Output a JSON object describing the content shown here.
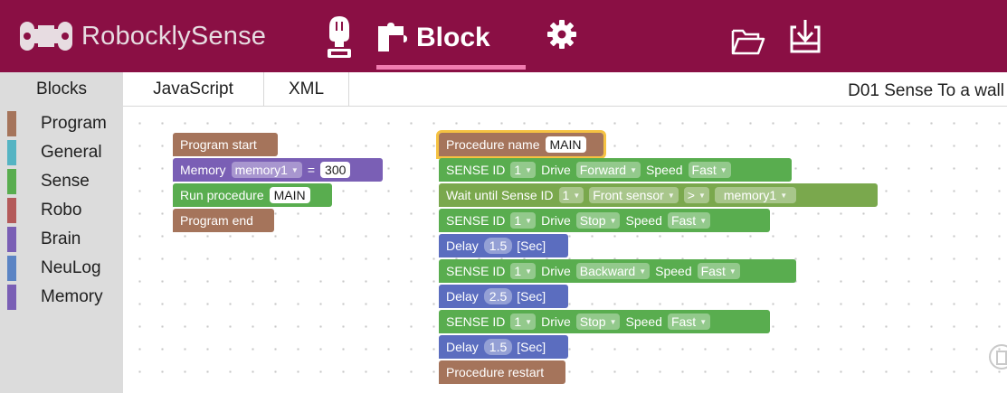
{
  "header": {
    "app_name": "RobocklySense",
    "active_tab_label": "Block",
    "icons": [
      "logo-icon",
      "robot-icon",
      "puzzle-icon",
      "gear-icon",
      "folder-icon",
      "download-icon"
    ],
    "brand_color": "#8a0f44",
    "active_underline_color": "#f07cb0"
  },
  "tabs": {
    "blocks": "Blocks",
    "javascript": "JavaScript",
    "xml": "XML"
  },
  "project_title": "D01 Sense To a wall",
  "toolbox": {
    "categories": [
      {
        "label": "Program",
        "color": "#a5745b"
      },
      {
        "label": "General",
        "color": "#55b4c3"
      },
      {
        "label": "Sense",
        "color": "#59ad4f"
      },
      {
        "label": "Robo",
        "color": "#b45a5a"
      },
      {
        "label": "Brain",
        "color": "#7a5fb5"
      },
      {
        "label": "NeuLog",
        "color": "#5b84c4"
      },
      {
        "label": "Memory",
        "color": "#7a5fb5"
      }
    ]
  },
  "program": {
    "start": "Program start",
    "memory_label": "Memory",
    "memory_var": "memory1",
    "equals": "=",
    "memory_value": "300",
    "run_label": "Run procedure",
    "run_name": "MAIN",
    "end": "Program end"
  },
  "procedure": {
    "name_label": "Procedure name",
    "name_value": "MAIN",
    "sense_label": "SENSE ID",
    "drive_label": "Drive",
    "speed_label": "Speed",
    "wait_label": "Wait until Sense ID",
    "delay_label": "Delay",
    "sec_label": "[Sec]",
    "restart": "Procedure restart",
    "s1": {
      "id": "1",
      "drive": "Forward",
      "speed": "Fast"
    },
    "wait": {
      "id": "1",
      "sensor": "Front sensor",
      "op": ">",
      "var": "memory1"
    },
    "s2": {
      "id": "1",
      "drive": "Stop",
      "speed": "Fast"
    },
    "d1": "1.5",
    "s3": {
      "id": "1",
      "drive": "Backward",
      "speed": "Fast"
    },
    "d2": "2.5",
    "s4": {
      "id": "1",
      "drive": "Stop",
      "speed": "Fast"
    },
    "d3": "1.5"
  }
}
